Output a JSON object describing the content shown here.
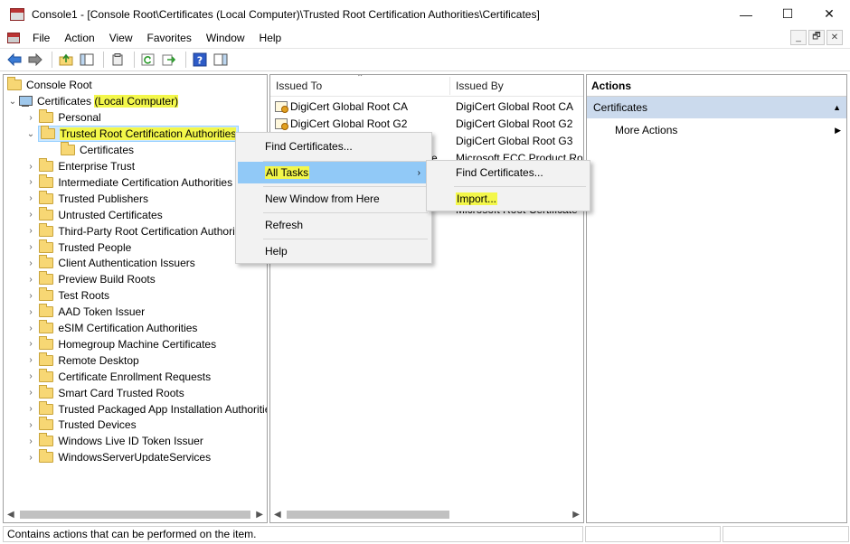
{
  "window": {
    "title": "Console1 - [Console Root\\Certificates (Local Computer)\\Trusted Root Certification Authorities\\Certificates]",
    "minimize": "—",
    "maximize": "☐",
    "close": "✕"
  },
  "menubar": {
    "items": [
      "File",
      "Action",
      "View",
      "Favorites",
      "Window",
      "Help"
    ],
    "mdi": [
      "_",
      "🗗",
      "✕"
    ]
  },
  "tree": {
    "root": "Console Root",
    "store": "Certificates",
    "store_suffix": "(Local Computer)",
    "personal": "Personal",
    "trca": "Trusted Root Certification Authorities",
    "trca_child": "Certificates",
    "items": [
      "Enterprise Trust",
      "Intermediate Certification Authorities",
      "Trusted Publishers",
      "Untrusted Certificates",
      "Third-Party Root Certification Authorities",
      "Trusted People",
      "Client Authentication Issuers",
      "Preview Build Roots",
      "Test Roots",
      "AAD Token Issuer",
      "eSIM Certification Authorities",
      "Homegroup Machine Certificates",
      "Remote Desktop",
      "Certificate Enrollment Requests",
      "Smart Card Trusted Roots",
      "Trusted Packaged App Installation Authorities",
      "Trusted Devices",
      "Windows Live ID Token Issuer",
      "WindowsServerUpdateServices"
    ]
  },
  "list": {
    "columns": [
      "Issued To",
      "Issued By"
    ],
    "rows": [
      {
        "issued_to": "DigiCert Global Root CA",
        "issued_by": "DigiCert Global Root CA"
      },
      {
        "issued_to": "DigiCert Global Root G2",
        "issued_by": "DigiCert Global Root G2"
      },
      {
        "issued_to": "",
        "issued_by": "DigiCert Global Root G3"
      },
      {
        "issued_to": "e",
        "issued_by": "Microsoft ECC Product Ro"
      },
      {
        "issued_to": "",
        "issued_by": "Microsoft Root Certificate"
      }
    ]
  },
  "actions": {
    "header": "Actions",
    "section": "Certificates",
    "items": [
      "More Actions"
    ]
  },
  "context_menu": {
    "items": [
      "Find Certificates...",
      "All Tasks",
      "New Window from Here",
      "Refresh",
      "Help"
    ],
    "submenu": [
      "Find Certificates...",
      "Import..."
    ]
  },
  "status": {
    "text": "Contains actions that can be performed on the item."
  },
  "colors": {
    "highlight": "#f3f74a",
    "menu_active": "#91c9f7",
    "actions_section": "#cbdaed"
  }
}
